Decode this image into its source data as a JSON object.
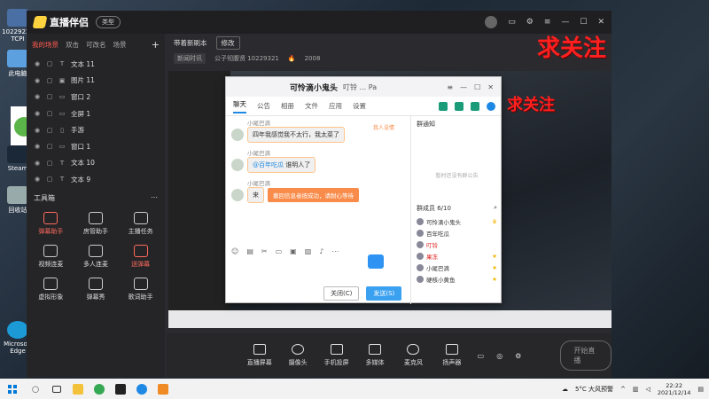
{
  "desktop_icons": [
    {
      "label": "10229221 TCPI"
    },
    {
      "label": "此电脑"
    },
    {
      "label": "Steam"
    },
    {
      "label": "回收站"
    },
    {
      "label": "Microsoft Edge"
    }
  ],
  "app": {
    "title": "直播伴侣",
    "version_pill": "类型"
  },
  "scene_tabs": [
    "我的场景",
    "双击",
    "可改名",
    "场景"
  ],
  "sources": [
    {
      "label": "文本 11"
    },
    {
      "label": "图片 11"
    },
    {
      "label": "窗口 2"
    },
    {
      "label": "全屏 1"
    },
    {
      "label": "手游"
    },
    {
      "label": "窗口 1"
    },
    {
      "label": "文本 10"
    },
    {
      "label": "文本 9"
    }
  ],
  "toolbox": {
    "title": "工具箱",
    "tools": [
      {
        "label": "弹幕助手",
        "highlight": true
      },
      {
        "label": "房管助手",
        "highlight": false
      },
      {
        "label": "主播任务",
        "highlight": false
      },
      {
        "label": "视频连麦",
        "highlight": false
      },
      {
        "label": "多人连麦",
        "highlight": false
      },
      {
        "label": "送弹幕",
        "highlight": true
      },
      {
        "label": "虚拟形象",
        "highlight": false
      },
      {
        "label": "弹幕秀",
        "highlight": false
      },
      {
        "label": "歌词助手",
        "highlight": false
      }
    ]
  },
  "room": {
    "name": "带着新刷本",
    "edit_label": "修改",
    "tag": "新闻时讯",
    "id_text": "公子彻腹贤  10229321",
    "hot": "2008"
  },
  "overlay": {
    "follow_large": "求关注",
    "follow_small": "求关注"
  },
  "chat": {
    "title": "可怜滴小鬼头",
    "title_suffix": "叮铃 ... Pa",
    "tabs": [
      "聊天",
      "公告",
      "相册",
      "文件",
      "应用",
      "设置"
    ],
    "messages": [
      {
        "sender": "小尾巴滴",
        "text": "四年我感觉我不太行，我太菜了"
      },
      {
        "sender": "小尾巴滴",
        "mention": "@百年吃瓜",
        "text": "谁明人了"
      },
      {
        "sender": "小尾巴滴",
        "text": "来"
      }
    ],
    "side_badge": "我人设情",
    "system_tip": "撤回信息者按成功，请耐心等待",
    "close_btn": "关闭(C)",
    "send_btn": "发送(S)",
    "group_notice": "群通知",
    "group_notice_empty": "暂时还没有群公告",
    "member_header": "群成员 6/10",
    "members": [
      {
        "name": "可怜滴小鬼头",
        "red": false
      },
      {
        "name": "百年吃瓜",
        "red": false
      },
      {
        "name": "叮铃",
        "red": true
      },
      {
        "name": "果冻",
        "red": true
      },
      {
        "name": "小尾巴滴",
        "red": false
      },
      {
        "name": "硬核小黄鱼",
        "red": false
      }
    ]
  },
  "bottom_bar": {
    "buttons": [
      "直播屏幕",
      "摄像头",
      "手机投屏",
      "多媒体",
      "麦克风",
      "扬声器"
    ],
    "live_button": "开始直播"
  },
  "taskbar": {
    "weather": "5°C 大风预警",
    "time": "22:22",
    "date": "2021/12/14"
  }
}
